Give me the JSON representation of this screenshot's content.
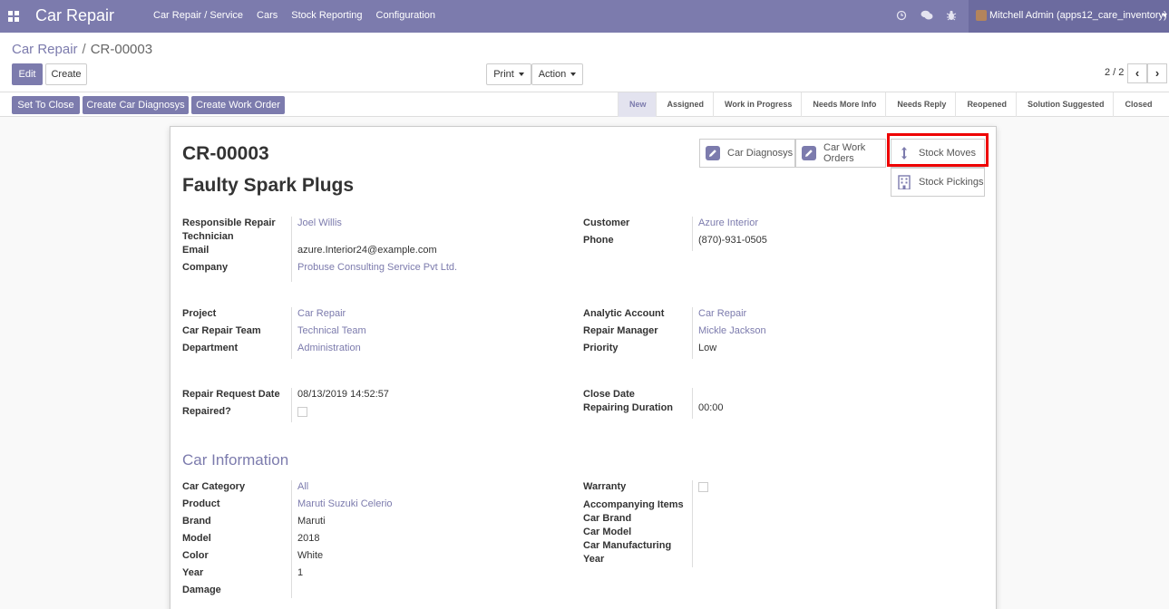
{
  "navbar": {
    "app_title": "Car Repair",
    "menu": [
      "Car Repair / Service",
      "Cars",
      "Stock Reporting",
      "Configuration"
    ],
    "user": "Mitchell Admin (apps12_care_inventory)",
    "icons": [
      "apps-icon",
      "clock-icon",
      "chat-icon",
      "bug-icon",
      "chevron-down-icon"
    ],
    "colors": {
      "primary": "#7c7bad",
      "user_area": "#6c6b9f"
    }
  },
  "breadcrumb": {
    "parent": "Car Repair",
    "separator": "/",
    "current": "CR-00003"
  },
  "toolbar": {
    "edit": "Edit",
    "create": "Create",
    "print": "Print",
    "action": "Action"
  },
  "pager": {
    "value": "2 / 2",
    "prev": "‹",
    "next": "›"
  },
  "header_buttons": [
    "Set To Close",
    "Create Car Diagnosys",
    "Create Work Order"
  ],
  "stages": [
    "New",
    "Assigned",
    "Work in Progress",
    "Needs More Info",
    "Needs Reply",
    "Reopened",
    "Solution Suggested",
    "Closed"
  ],
  "active_stage": "New",
  "smart_buttons": {
    "car_diagnosys": "Car Diagnosys",
    "car_work_orders_1": "Car Work",
    "car_work_orders_2": "Orders",
    "stock_moves": "Stock Moves",
    "stock_pickings": "Stock Pickings"
  },
  "record": {
    "ref": "CR-00003",
    "name": "Faulty Spark Plugs"
  },
  "fields": {
    "responsible_label_1": "Responsible Repair",
    "responsible_label_2": "Technician",
    "responsible": "Joel Willis",
    "email_label": "Email",
    "email": "azure.Interior24@example.com",
    "company_label": "Company",
    "company": "Probuse Consulting Service Pvt Ltd.",
    "customer_label": "Customer",
    "customer": "Azure Interior",
    "phone_label": "Phone",
    "phone": "(870)-931-0505",
    "project_label": "Project",
    "project": "Car Repair",
    "team_label": "Car Repair Team",
    "team": "Technical Team",
    "department_label": "Department",
    "department": "Administration",
    "analytic_label": "Analytic Account",
    "analytic": "Car Repair",
    "manager_label": "Repair Manager",
    "manager": "Mickle Jackson",
    "priority_label": "Priority",
    "priority": "Low",
    "request_date_label": "Repair Request Date",
    "request_date": "08/13/2019 14:52:57",
    "repaired_label": "Repaired?",
    "repaired": false,
    "close_date_label": "Close Date",
    "close_date": "",
    "duration_label": "Repairing Duration",
    "duration": "00:00"
  },
  "car_info": {
    "title": "Car Information",
    "category_label": "Car Category",
    "category": "All",
    "product_label": "Product",
    "product": "Maruti Suzuki Celerio",
    "brand_label": "Brand",
    "brand": "Maruti",
    "model_label": "Model",
    "model": "2018",
    "color_label": "Color",
    "color": "White",
    "year_label": "Year",
    "year": "1",
    "damage_label": "Damage",
    "warranty_label": "Warranty",
    "warranty": false,
    "accompanying_label": "Accompanying Items",
    "car_brand_label": "Car Brand",
    "car_model_label": "Car Model",
    "car_mfg_label_1": "Car Manufacturing",
    "car_mfg_label_2": "Year"
  }
}
